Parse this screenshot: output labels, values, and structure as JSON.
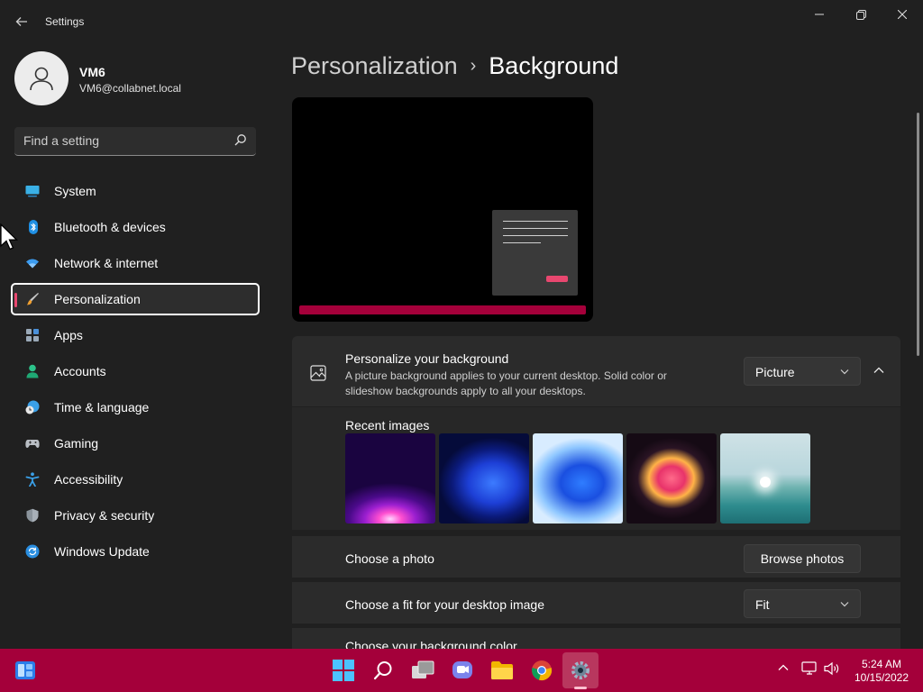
{
  "window": {
    "title": "Settings",
    "back_icon": "back-arrow-icon",
    "controls": [
      "minimize-icon",
      "maximize-icon",
      "close-icon"
    ]
  },
  "profile": {
    "name": "VM6",
    "email": "VM6@collabnet.local",
    "avatar_icon": "person-icon"
  },
  "search": {
    "placeholder": "Find a setting",
    "value": "",
    "icon": "search-icon"
  },
  "sidebar": {
    "items": [
      {
        "label": "System",
        "icon": "system-display-icon",
        "active": false
      },
      {
        "label": "Bluetooth & devices",
        "icon": "bluetooth-icon",
        "active": false
      },
      {
        "label": "Network & internet",
        "icon": "wifi-icon",
        "active": false
      },
      {
        "label": "Personalization",
        "icon": "paintbrush-icon",
        "active": true
      },
      {
        "label": "Apps",
        "icon": "apps-icon",
        "active": false
      },
      {
        "label": "Accounts",
        "icon": "accounts-icon",
        "active": false
      },
      {
        "label": "Time & language",
        "icon": "clock-globe-icon",
        "active": false
      },
      {
        "label": "Gaming",
        "icon": "gamepad-icon",
        "active": false
      },
      {
        "label": "Accessibility",
        "icon": "accessibility-icon",
        "active": false
      },
      {
        "label": "Privacy & security",
        "icon": "shield-icon",
        "active": false
      },
      {
        "label": "Windows Update",
        "icon": "update-icon",
        "active": false
      }
    ]
  },
  "breadcrumb": {
    "parent": "Personalization",
    "separator": "›",
    "current": "Background"
  },
  "background_section": {
    "title": "Personalize your background",
    "description": "A picture background applies to your current desktop. Solid color or slideshow backgrounds apply to all your desktops.",
    "type_dropdown": "Picture",
    "recent_images_label": "Recent images",
    "recent_images": [
      "purple-glow-wallpaper",
      "blue-bloom-dark-wallpaper",
      "blue-bloom-light-wallpaper",
      "pink-ribbon-wallpaper",
      "lake-sunrise-wallpaper"
    ],
    "choose_photo_label": "Choose a photo",
    "browse_button": "Browse photos",
    "fit_label": "Choose a fit for your desktop image",
    "fit_dropdown": "Fit",
    "color_label": "Choose your background color"
  },
  "taskbar": {
    "apps": [
      "start-icon",
      "search-icon",
      "task-view-icon",
      "teams-chat-icon",
      "file-explorer-icon",
      "chrome-icon",
      "settings-icon"
    ],
    "time": "5:24 AM",
    "date": "10/15/2022"
  },
  "colors": {
    "window_bg": "#202020",
    "card_bg": "#2b2b2b",
    "accent": "#e8476f",
    "taskbar": "#a4003a"
  }
}
